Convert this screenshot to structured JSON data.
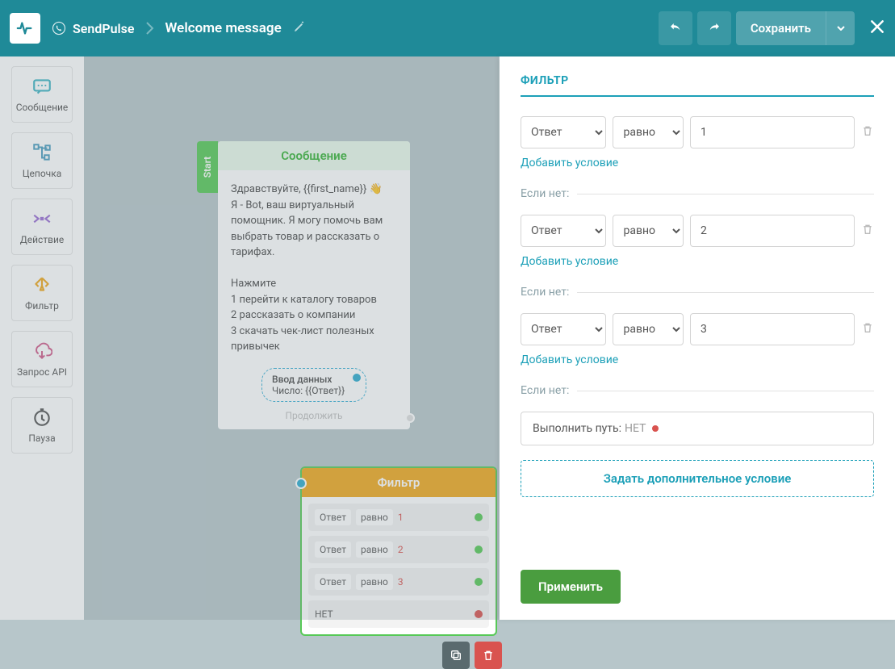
{
  "header": {
    "brand": "SendPulse",
    "flow_title": "Welcome message",
    "save_label": "Сохранить"
  },
  "sidebar": {
    "items": [
      {
        "label": "Сообщение"
      },
      {
        "label": "Цепочка"
      },
      {
        "label": "Действие"
      },
      {
        "label": "Фильтр"
      },
      {
        "label": "Запрос API"
      },
      {
        "label": "Пауза"
      }
    ]
  },
  "canvas": {
    "start_label": "Start",
    "message_node": {
      "title": "Сообщение",
      "line1": "Здравствуйте,  {{first_name}} 👋",
      "line2": "Я - Bot, ваш виртуальный помощник. Я могу помочь вам выбрать товар и рассказать о тарифах.",
      "line3": "Нажмите",
      "opt1": "1 перейти к каталогу товаров",
      "opt2": "2 рассказать о компании",
      "opt3": "3 скачать чек-лист полезных привычек",
      "input_title": "Ввод данных",
      "input_sub": "Число: {{Ответ}}",
      "continue": "Продолжить"
    },
    "filter_node": {
      "title": "Фильтр",
      "rows": [
        {
          "field": "Ответ",
          "op": "равно",
          "val": "1"
        },
        {
          "field": "Ответ",
          "op": "равно",
          "val": "2"
        },
        {
          "field": "Ответ",
          "op": "равно",
          "val": "3"
        }
      ],
      "no_label": "НЕТ"
    }
  },
  "panel": {
    "title": "ФИЛЬТР",
    "conditions": [
      {
        "field": "Ответ",
        "op": "равно",
        "val": "1"
      },
      {
        "field": "Ответ",
        "op": "равно",
        "val": "2"
      },
      {
        "field": "Ответ",
        "op": "равно",
        "val": "3"
      }
    ],
    "add_condition": "Добавить условие",
    "else_label": "Если нет:",
    "execute_path": "Выполнить путь:",
    "execute_val": "НЕТ",
    "add_block": "Задать дополнительное условие",
    "apply": "Применить"
  }
}
